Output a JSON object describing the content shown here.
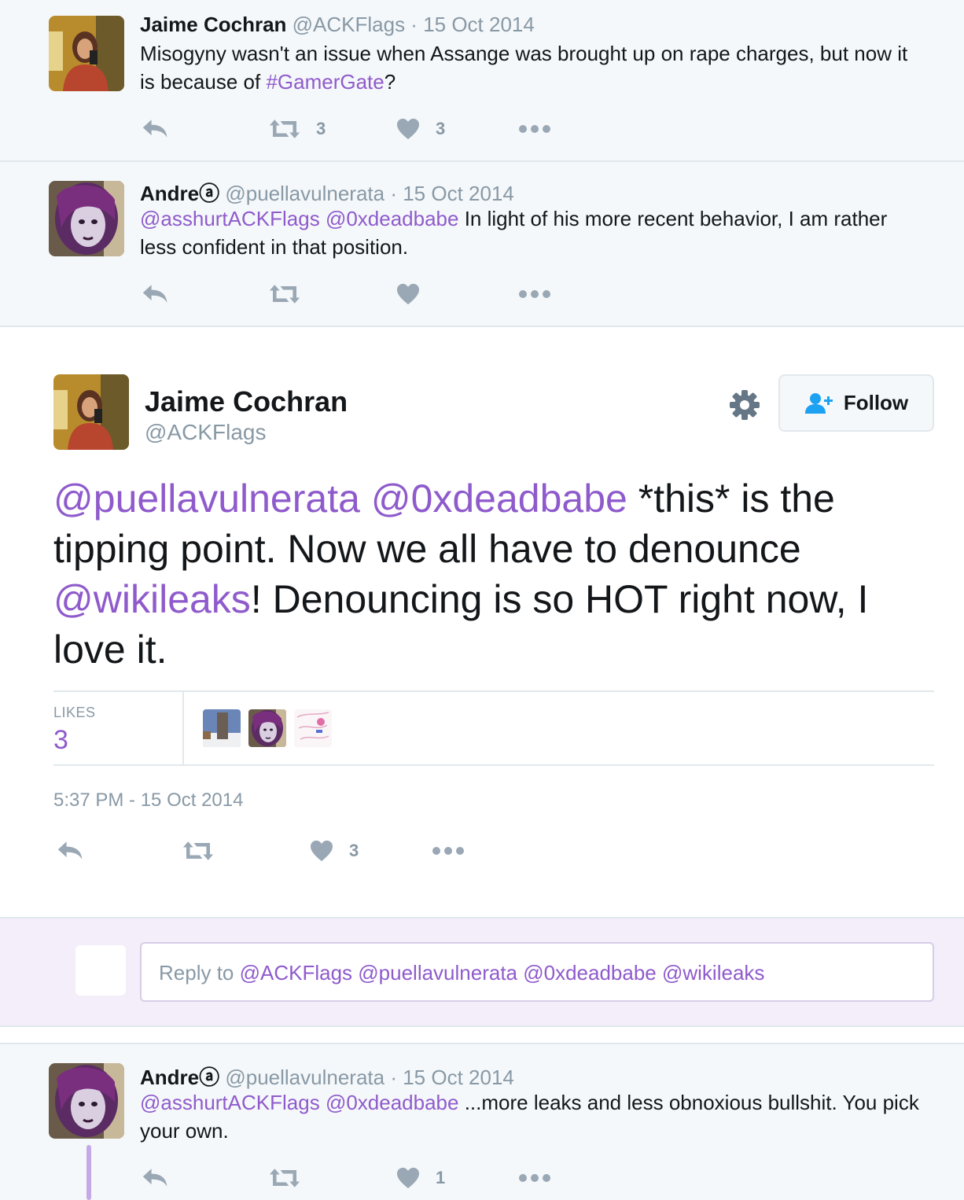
{
  "colors": {
    "link": "#8f5bcc",
    "muted": "#8899a6",
    "text": "#14171a",
    "background_small": "#f5f8fa",
    "reply_box_bg": "#f3eef9"
  },
  "tweet1": {
    "name": "Jaime Cochran",
    "handle": "@ACKFlags",
    "sep": " · ",
    "date": "15 Oct 2014",
    "text_1": "Misogyny wasn't an issue when Assange was brought up on rape charges, but now it is because of ",
    "hashtag": "#GamerGate",
    "text_2": "?",
    "retweets": "3",
    "likes": "3"
  },
  "tweet2": {
    "name": "Andreⓐ",
    "handle": "@puellavulnerata",
    "sep": " · ",
    "date": "15 Oct 2014",
    "mention_1": "@asshurtACKFlags",
    "mention_2": "@0xdeadbabe",
    "text": " In light of his more recent behavior, I am rather less confident in that position."
  },
  "main_tweet": {
    "name": "Jaime Cochran",
    "handle": "@ACKFlags",
    "follow_label": "Follow",
    "mention_1": "@puellavulnerata",
    "mention_2": "@0xdeadbabe",
    "text_1": " *this* is the tipping point. Now we all have to denounce ",
    "mention_3": "@wikileaks",
    "text_2": "! Denouncing is so HOT right now, I love it.",
    "likes_label": "LIKES",
    "likes_count": "3",
    "timestamp": "5:37 PM - 15 Oct 2014",
    "action_likes": "3"
  },
  "reply_box": {
    "prefix": "Reply to ",
    "mentions": "@ACKFlags @puellavulnerata @0xdeadbabe @wikileaks"
  },
  "tweet3": {
    "name": "Andreⓐ",
    "handle": "@puellavulnerata",
    "sep": " · ",
    "date": "15 Oct 2014",
    "mention_1": "@asshurtACKFlags",
    "mention_2": "@0xdeadbabe",
    "text": " ...more leaks and less obnoxious bullshit. You pick your own.",
    "likes": "1"
  },
  "icons": [
    "reply-icon",
    "retweet-icon",
    "heart-icon",
    "more-icon",
    "gear-icon",
    "follow-person-icon"
  ]
}
